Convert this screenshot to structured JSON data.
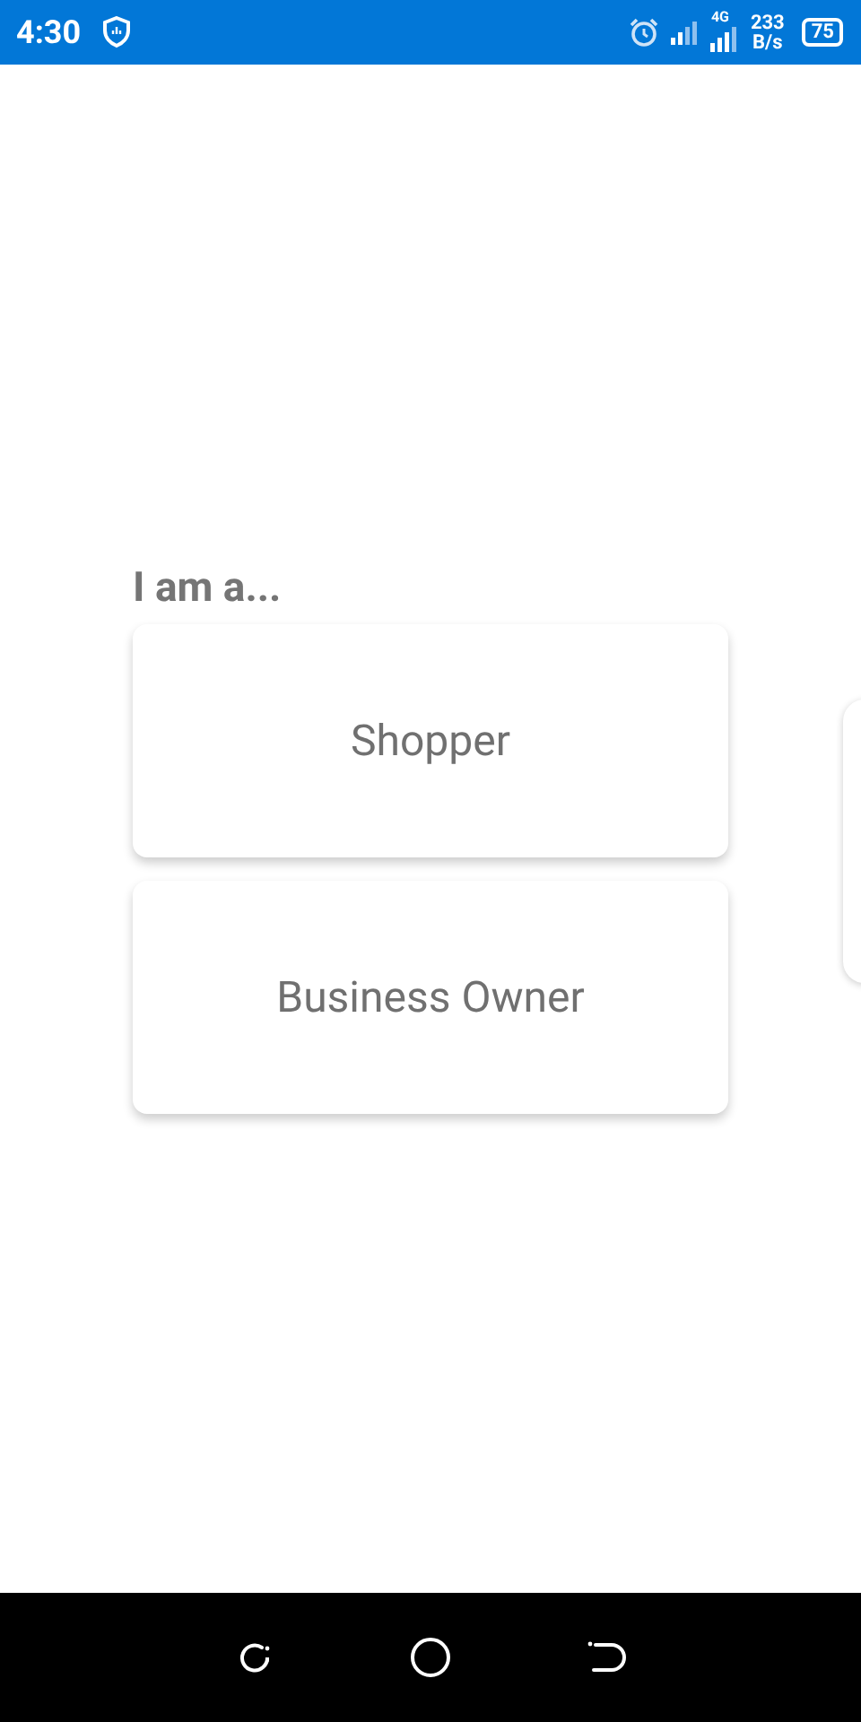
{
  "status_bar": {
    "time": "4:30",
    "network": "4G",
    "speed_value": "233",
    "speed_unit": "B/s",
    "battery": "75"
  },
  "prompt": "I am a...",
  "options": [
    {
      "label": "Shopper"
    },
    {
      "label": "Business Owner"
    }
  ],
  "nav_bar": {
    "buttons": [
      {
        "kind": "recent"
      },
      {
        "kind": "home"
      },
      {
        "kind": "back"
      }
    ]
  }
}
